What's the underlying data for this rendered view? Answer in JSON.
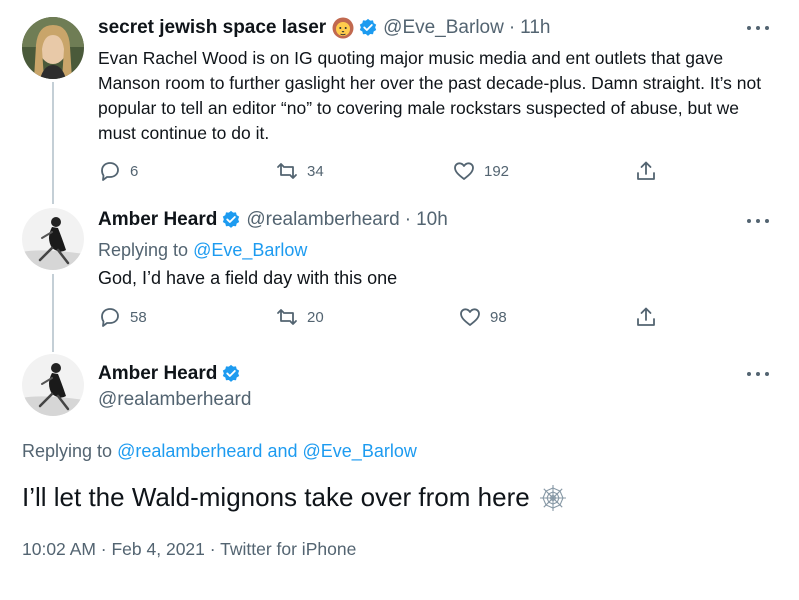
{
  "tweet1": {
    "display_name": "secret jewish space laser",
    "handle": "@Eve_Barlow",
    "dot": "·",
    "time": "11h",
    "name_emoji": "lion-face",
    "text": "Evan Rachel Wood is on IG quoting major music media and ent outlets that gave Manson room to further gaslight her over the past decade-plus. Damn straight. It’s not popular to tell an editor “no” to covering male rockstars suspected of abuse, but we must continue to do it.",
    "replies": "6",
    "retweets": "34",
    "likes": "192"
  },
  "tweet2": {
    "display_name": "Amber Heard",
    "handle": "@realamberheard",
    "dot": "·",
    "time": "10h",
    "replying_prefix": "Replying to",
    "replying_to": "@Eve_Barlow",
    "text": "God, I’d have a field day with this one",
    "replies": "58",
    "retweets": "20",
    "likes": "98"
  },
  "main_tweet": {
    "display_name": "Amber Heard",
    "handle": "@realamberheard",
    "replying_prefix": "Replying to",
    "replying_to_1": "@realamberheard",
    "and_word": "and",
    "replying_to_2": "@Eve_Barlow",
    "text": "I’ll let the Wald-mignons take over from here",
    "text_emoji": "spider-web",
    "timestamp": "10:02 AM · Feb 4, 2021 · Twitter for iPhone"
  },
  "colors": {
    "accent": "#1d9bf0",
    "secondary_text": "#536471",
    "primary_text": "#0f1419",
    "thread_line": "#c4cfd6"
  }
}
